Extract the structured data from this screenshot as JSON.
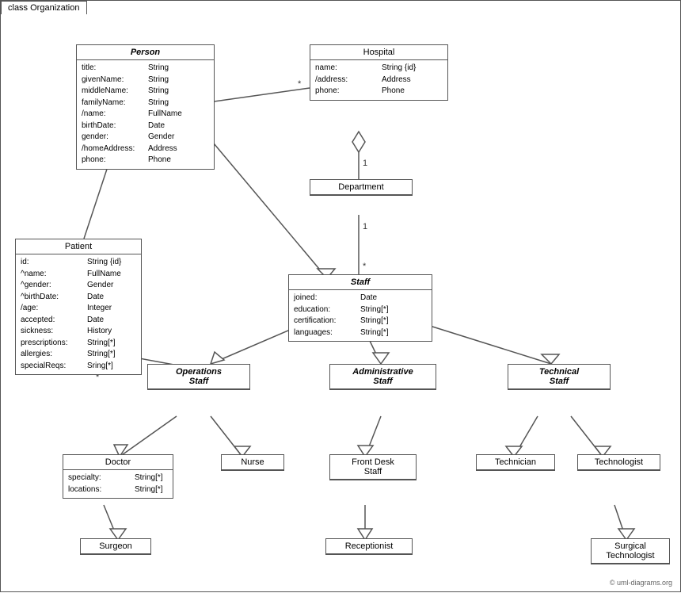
{
  "diagram": {
    "title": "class Organization",
    "copyright": "© uml-diagrams.org",
    "classes": {
      "person": {
        "name": "Person",
        "italic": true,
        "attrs": [
          {
            "name": "title:",
            "type": "String"
          },
          {
            "name": "givenName:",
            "type": "String"
          },
          {
            "name": "middleName:",
            "type": "String"
          },
          {
            "name": "familyName:",
            "type": "String"
          },
          {
            "name": "/name:",
            "type": "FullName"
          },
          {
            "name": "birthDate:",
            "type": "Date"
          },
          {
            "name": "gender:",
            "type": "Gender"
          },
          {
            "name": "/homeAddress:",
            "type": "Address"
          },
          {
            "name": "phone:",
            "type": "Phone"
          }
        ]
      },
      "hospital": {
        "name": "Hospital",
        "italic": false,
        "attrs": [
          {
            "name": "name:",
            "type": "String {id}"
          },
          {
            "name": "/address:",
            "type": "Address"
          },
          {
            "name": "phone:",
            "type": "Phone"
          }
        ]
      },
      "department": {
        "name": "Department",
        "italic": false,
        "attrs": []
      },
      "staff": {
        "name": "Staff",
        "italic": true,
        "attrs": [
          {
            "name": "joined:",
            "type": "Date"
          },
          {
            "name": "education:",
            "type": "String[*]"
          },
          {
            "name": "certification:",
            "type": "String[*]"
          },
          {
            "name": "languages:",
            "type": "String[*]"
          }
        ]
      },
      "patient": {
        "name": "Patient",
        "italic": false,
        "attrs": [
          {
            "name": "id:",
            "type": "String {id}"
          },
          {
            "name": "^name:",
            "type": "FullName"
          },
          {
            "name": "^gender:",
            "type": "Gender"
          },
          {
            "name": "^birthDate:",
            "type": "Date"
          },
          {
            "name": "/age:",
            "type": "Integer"
          },
          {
            "name": "accepted:",
            "type": "Date"
          },
          {
            "name": "sickness:",
            "type": "History"
          },
          {
            "name": "prescriptions:",
            "type": "String[*]"
          },
          {
            "name": "allergies:",
            "type": "String[*]"
          },
          {
            "name": "specialReqs:",
            "type": "Sring[*]"
          }
        ]
      },
      "ops_staff": {
        "name": "Operations\nStaff",
        "italic": true,
        "attrs": []
      },
      "admin_staff": {
        "name": "Administrative\nStaff",
        "italic": true,
        "attrs": []
      },
      "tech_staff": {
        "name": "Technical\nStaff",
        "italic": true,
        "attrs": []
      },
      "doctor": {
        "name": "Doctor",
        "italic": false,
        "attrs": [
          {
            "name": "specialty:",
            "type": "String[*]"
          },
          {
            "name": "locations:",
            "type": "String[*]"
          }
        ]
      },
      "nurse": {
        "name": "Nurse",
        "italic": false,
        "attrs": []
      },
      "front_desk": {
        "name": "Front Desk\nStaff",
        "italic": false,
        "attrs": []
      },
      "technician": {
        "name": "Technician",
        "italic": false,
        "attrs": []
      },
      "technologist": {
        "name": "Technologist",
        "italic": false,
        "attrs": []
      },
      "surgeon": {
        "name": "Surgeon",
        "italic": false,
        "attrs": []
      },
      "receptionist": {
        "name": "Receptionist",
        "italic": false,
        "attrs": []
      },
      "surgical_tech": {
        "name": "Surgical\nTechnologist",
        "italic": false,
        "attrs": []
      }
    }
  }
}
